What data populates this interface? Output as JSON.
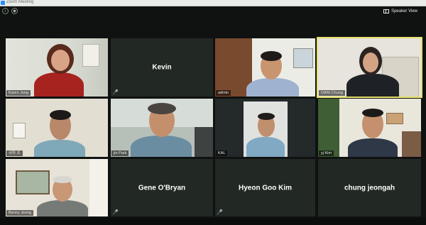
{
  "window": {
    "title": "Zoom Meeting"
  },
  "toolbar": {
    "info_icon": "info-icon",
    "shield_icon": "shield-icon",
    "speaker_view_label": "Speaker View"
  },
  "tiles": [
    {
      "name": "Karen Jung",
      "type": "video",
      "active": false
    },
    {
      "name": "Kevin",
      "type": "name-only",
      "muted": true
    },
    {
      "name": "admin",
      "type": "video",
      "active": false
    },
    {
      "name": "DANI Chung",
      "type": "video",
      "active": true
    },
    {
      "name": "샤하 조",
      "type": "video",
      "active": false
    },
    {
      "name": "jin Park",
      "type": "video",
      "active": false
    },
    {
      "name": "KAL",
      "type": "video",
      "active": false
    },
    {
      "name": "yj Kim",
      "type": "video",
      "active": false
    },
    {
      "name": "Benny Jeong",
      "type": "video",
      "active": false
    },
    {
      "name": "Gene O'Bryan",
      "type": "name-only",
      "muted": true
    },
    {
      "name": "Hyeon Goo Kim",
      "type": "name-only",
      "muted": true
    },
    {
      "name": "chung jeongah",
      "type": "name-only",
      "muted": false
    }
  ]
}
